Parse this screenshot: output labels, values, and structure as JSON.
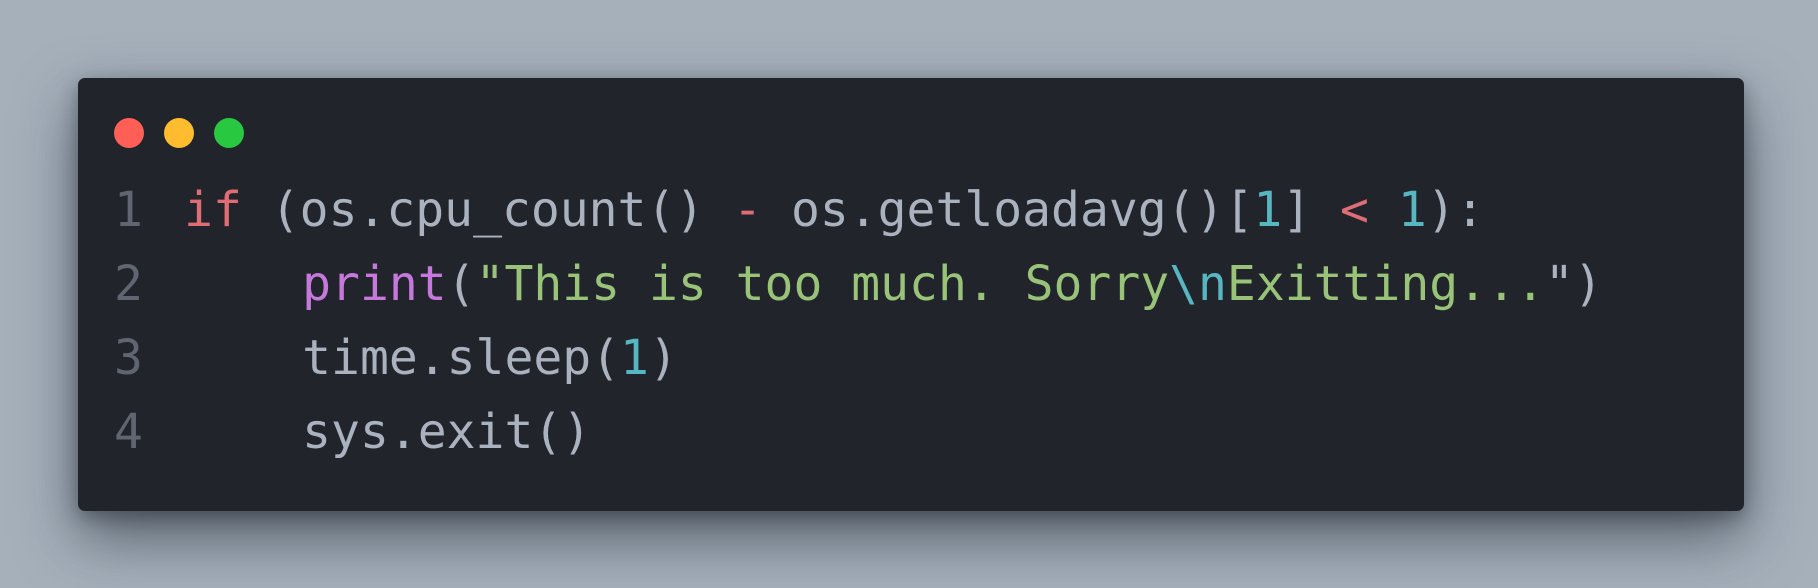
{
  "theme": {
    "background": "#a5b0bb",
    "editor_bg": "#21252b",
    "plain": "#abb2bf",
    "line_number": "#5f6672",
    "keyword": "#e06c75",
    "function": "#c678dd",
    "string": "#98c379",
    "number": "#56b6c2",
    "escape": "#56b6c2"
  },
  "window_controls": [
    {
      "name": "close",
      "color": "#ff5f57"
    },
    {
      "name": "minimize",
      "color": "#febc2e"
    },
    {
      "name": "zoom",
      "color": "#28c840"
    }
  ],
  "code": {
    "language": "python",
    "lines": [
      {
        "number": "1",
        "indent": false,
        "tokens": [
          {
            "text": "if",
            "type": "keyword"
          },
          {
            "text": " (os.cpu_count() ",
            "type": "plain"
          },
          {
            "text": "-",
            "type": "keyword"
          },
          {
            "text": " os.getloadavg()[",
            "type": "plain"
          },
          {
            "text": "1",
            "type": "number"
          },
          {
            "text": "] ",
            "type": "plain"
          },
          {
            "text": "<",
            "type": "keyword"
          },
          {
            "text": " ",
            "type": "plain"
          },
          {
            "text": "1",
            "type": "number"
          },
          {
            "text": "):",
            "type": "plain"
          }
        ]
      },
      {
        "number": "2",
        "indent": true,
        "tokens": [
          {
            "text": "print",
            "type": "function"
          },
          {
            "text": "(",
            "type": "plain"
          },
          {
            "text": "\"This is too much. Sorry",
            "type": "string"
          },
          {
            "text": "\\n",
            "type": "escape"
          },
          {
            "text": "Exitting...",
            "type": "string"
          },
          {
            "text": "\"",
            "type": "plain"
          },
          {
            "text": ")",
            "type": "plain"
          }
        ]
      },
      {
        "number": "3",
        "indent": true,
        "tokens": [
          {
            "text": "time.sleep(",
            "type": "plain"
          },
          {
            "text": "1",
            "type": "number"
          },
          {
            "text": ")",
            "type": "plain"
          }
        ]
      },
      {
        "number": "4",
        "indent": true,
        "tokens": [
          {
            "text": "sys.exit()",
            "type": "plain"
          }
        ]
      }
    ]
  }
}
